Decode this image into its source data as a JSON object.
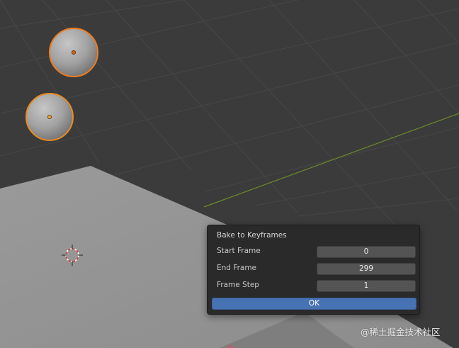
{
  "viewport": {
    "background_color": "#3b3b3b",
    "grid_color": "#474747",
    "axis_color": "#6b8a2b",
    "plane_color": "#979797",
    "sphere_outline_active": "#ef7b1f",
    "sphere_outline_selected": "#e98b22"
  },
  "dialog": {
    "title": "Bake to Keyframes",
    "fields": [
      {
        "label": "Start Frame",
        "value": "0"
      },
      {
        "label": "End Frame",
        "value": "299"
      },
      {
        "label": "Frame Step",
        "value": "1"
      }
    ],
    "ok_label": "OK",
    "accent_color": "#4772b3"
  },
  "watermark": "@稀土掘金技术社区"
}
